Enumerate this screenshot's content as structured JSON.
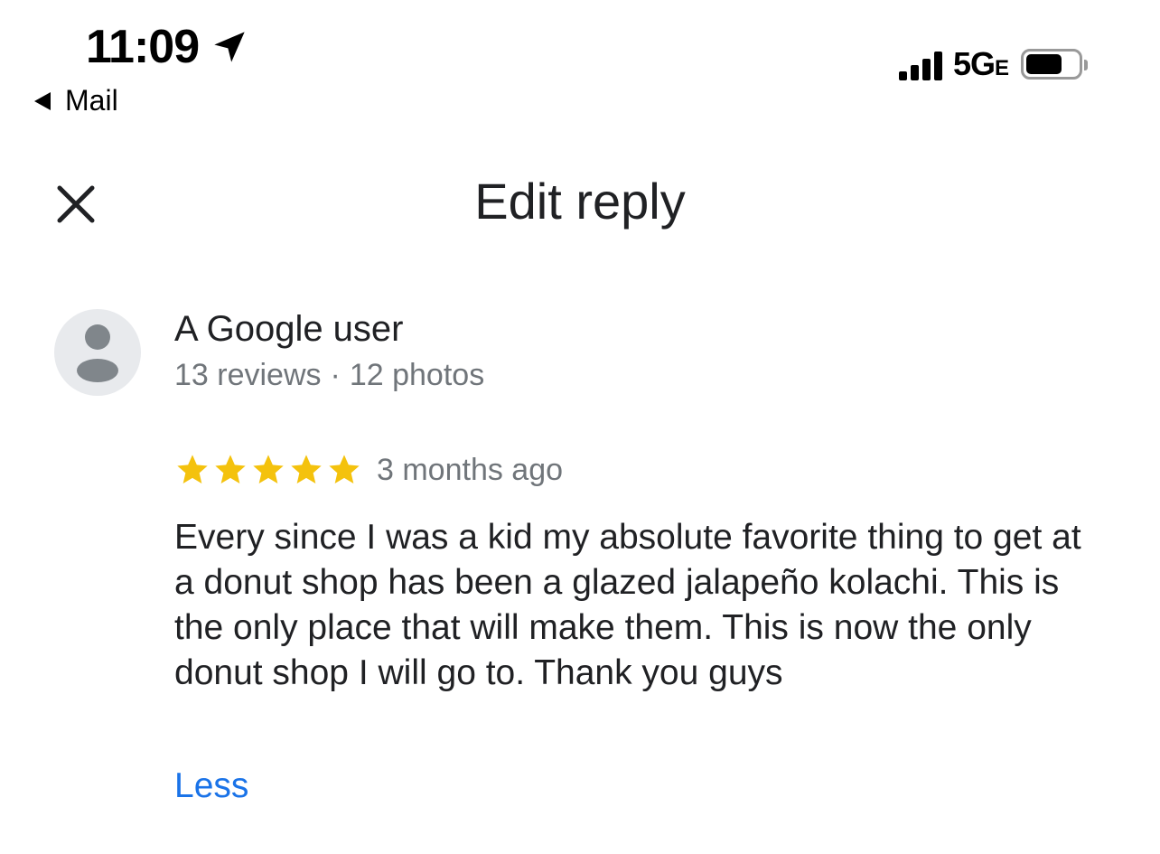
{
  "status_bar": {
    "time": "11:09",
    "back_label": "Mail",
    "network": "5G",
    "network_suffix": "E",
    "signal_bars": 4,
    "battery_level": 0.7
  },
  "header": {
    "title": "Edit reply"
  },
  "review": {
    "reviewer_name": "A Google user",
    "reviews_count": "13 reviews",
    "separator": "·",
    "photos_count": "12 photos",
    "rating": 5,
    "time_ago": "3 months ago",
    "text": "Every since I was a kid my absolute favorite thing to get at a donut shop has been a glazed jalapeño kolachi. This is the only place that will make them. This is now the only donut shop I will go to. Thank you guys",
    "less_label": "Less"
  },
  "colors": {
    "star": "#f4c20d",
    "link": "#1a73e8",
    "secondary_text": "#70757a",
    "avatar_bg": "#e8eaed",
    "avatar_figure": "#80868b"
  },
  "icons": {
    "location": "location-arrow-icon",
    "back": "back-triangle-icon",
    "signal": "cellular-signal-icon",
    "battery": "battery-icon",
    "close": "close-icon",
    "avatar": "person-icon",
    "star": "star-icon"
  }
}
